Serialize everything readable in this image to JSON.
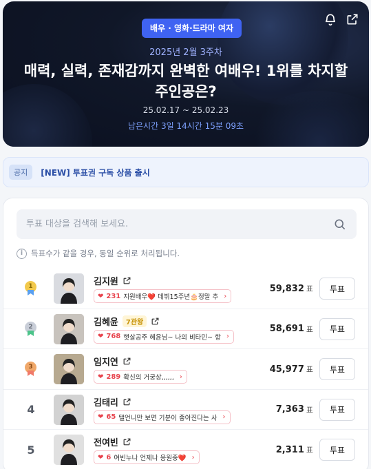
{
  "hero": {
    "category": "배우 · 영화·드라마 여자",
    "week": "2025년 2월 3주차",
    "title": "매력, 실력, 존재감까지 완벽한 여배우! 1위를 차지할 주인공은?",
    "period": "25.02.17 ~ 25.02.23",
    "remaining": "남은시간 3일 14시간 15분 09초"
  },
  "notice": {
    "tag": "공지",
    "text": "[NEW] 투표권 구독 상품 출시"
  },
  "search": {
    "placeholder": "투표 대상을 검색해 보세요."
  },
  "info": "득표수가 같을 경우, 동일 순위로 처리됩니다.",
  "vote_label": "투표",
  "vote_unit": "표",
  "ranking": [
    {
      "rank": "1",
      "name": "김지원",
      "badge": "",
      "cheer_count": "231",
      "cheer_msg": "지원배우❤️ 데뷔15주년🎂정말 추",
      "votes": "59,832"
    },
    {
      "rank": "2",
      "name": "김혜윤",
      "badge": "7관왕",
      "cheer_count": "768",
      "cheer_msg": "햇살공주 혜윤님~ 나의 비타민~ 항",
      "votes": "58,691"
    },
    {
      "rank": "3",
      "name": "임지연",
      "badge": "",
      "cheer_count": "289",
      "cheer_msg": "확신의 거궁상,,,,,,",
      "votes": "45,977"
    },
    {
      "rank": "4",
      "name": "김태리",
      "badge": "",
      "cheer_count": "65",
      "cheer_msg": "탤언니만 보면 기분이 좋아진다는 사",
      "votes": "7,363"
    },
    {
      "rank": "5",
      "name": "전여빈",
      "badge": "",
      "cheer_count": "6",
      "cheer_msg": "여빈누나 언제나 응원중❤️",
      "votes": "2,311"
    }
  ],
  "colors": {
    "accent": "#3f63f2",
    "heart": "#e8434d",
    "gold": "#f2c94c",
    "silver": "#c9ced8",
    "bronze": "#f0a86a"
  }
}
